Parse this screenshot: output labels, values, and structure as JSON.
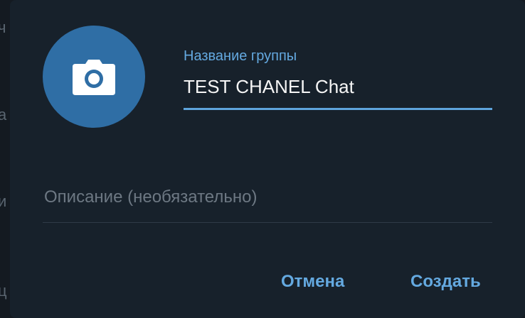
{
  "background_fragments": [
    "ч",
    "а",
    "и",
    "ц"
  ],
  "dialog": {
    "avatar": {
      "icon": "camera-icon",
      "color": "#2f6ea5"
    },
    "name_field": {
      "label": "Название группы",
      "value": "TEST CHANEL Chat"
    },
    "description_field": {
      "placeholder": "Описание (необязательно)",
      "value": ""
    },
    "buttons": {
      "cancel": "Отмена",
      "create": "Создать"
    },
    "colors": {
      "accent": "#64a9e0",
      "background": "#17212b"
    }
  }
}
